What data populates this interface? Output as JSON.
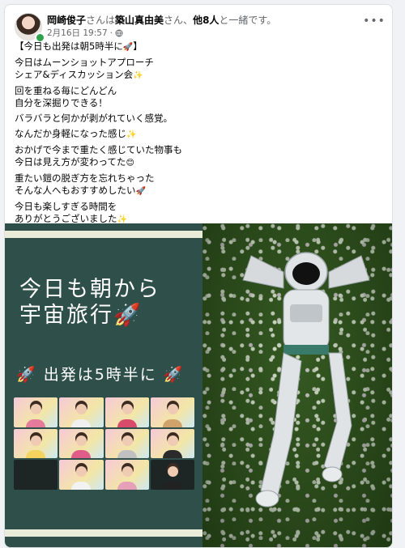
{
  "post": {
    "author": "岡崎俊子",
    "with_connector": "さんは",
    "tagged": "築山真由美",
    "tagged_suffix": "さん、",
    "others": "他8人",
    "with_tail": "と一緒です。",
    "date": "2月16日 19:57",
    "dot": "·",
    "more_icon": "more-horizontal-icon",
    "text": [
      {
        "text": "【今日も出発は朝5時半に",
        "emoji": "🚀",
        "tail": "】"
      },
      {
        "text": "今日はムーンショットアプローチ\nシェア&ディスカッション会",
        "emoji": "✨",
        "tail": ""
      },
      {
        "text": "回を重ねる毎にどんどん\n自分を深掘りできる！",
        "emoji": "",
        "tail": ""
      },
      {
        "text": "バラバラと何かが剥がれていく感覚。",
        "emoji": "",
        "tail": ""
      },
      {
        "text": "なんだか身軽になった感じ",
        "emoji": "✨",
        "tail": ""
      },
      {
        "text": "おかげで今まで重たく感じていた物事も\n今日は見え方が変わってた",
        "emoji": "😊",
        "tail": ""
      },
      {
        "text": "重たい鎧の脱ぎ方を忘れちゃった\nそんな人へもおすすめしたい",
        "emoji": "🚀",
        "tail": ""
      },
      {
        "text": "今日も楽しすぎる時間を\nありがとうございました",
        "emoji": "✨",
        "tail": ""
      }
    ]
  },
  "image": {
    "title_line1": "今日も朝から",
    "title_line2": "宇宙旅行",
    "title_rocket": "🚀",
    "subtitle_rocket_left": "🚀",
    "subtitle": "出発は5時半に",
    "subtitle_rocket_right": "🚀",
    "tiles": [
      "pink",
      "pink",
      "pink",
      "pink",
      "pink",
      "pink",
      "pink",
      "pink",
      "dark",
      "pink",
      "pink",
      "dark"
    ],
    "panel_color": "#2f4f4a"
  }
}
